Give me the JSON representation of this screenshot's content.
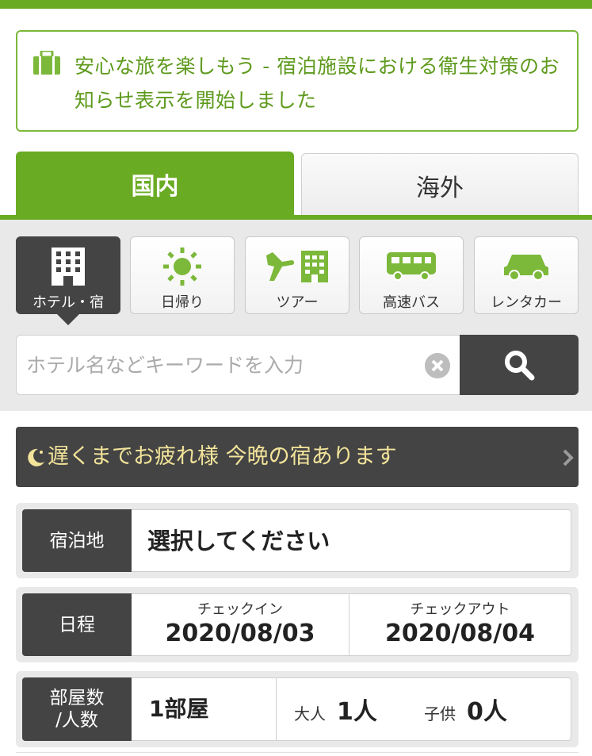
{
  "notice": {
    "text": "安心な旅を楽しもう - 宿泊施設における衛生対策のお知らせ表示を開始しました"
  },
  "tabs": [
    {
      "label": "国内",
      "active": true
    },
    {
      "label": "海外",
      "active": false
    }
  ],
  "categories": [
    {
      "label": "ホテル・宿",
      "icon": "building-icon",
      "active": true
    },
    {
      "label": "日帰り",
      "icon": "sun-icon",
      "active": false
    },
    {
      "label": "ツアー",
      "icon": "plane-building-icon",
      "active": false
    },
    {
      "label": "高速バス",
      "icon": "bus-icon",
      "active": false
    },
    {
      "label": "レンタカー",
      "icon": "car-icon",
      "active": false
    }
  ],
  "search": {
    "placeholder": "ホテル名などキーワードを入力",
    "value": ""
  },
  "late_banner": {
    "text": "遅くまでお疲れ様 今晩の宿あります"
  },
  "form": {
    "destination": {
      "label": "宿泊地",
      "value": "選択してください"
    },
    "schedule": {
      "label": "日程",
      "checkin_label": "チェックイン",
      "checkin": "2020/08/03",
      "checkout_label": "チェックアウト",
      "checkout": "2020/08/04"
    },
    "rooms": {
      "label_line1": "部屋数",
      "label_line2": "/人数",
      "rooms": "1部屋",
      "adult_label": "大人",
      "adult": "1人",
      "child_label": "子供",
      "child": "0人"
    }
  },
  "colors": {
    "brand_green": "#6aab24",
    "notice_text": "#5e9a1d",
    "dark": "#444444",
    "late_text": "#f3e49a"
  }
}
